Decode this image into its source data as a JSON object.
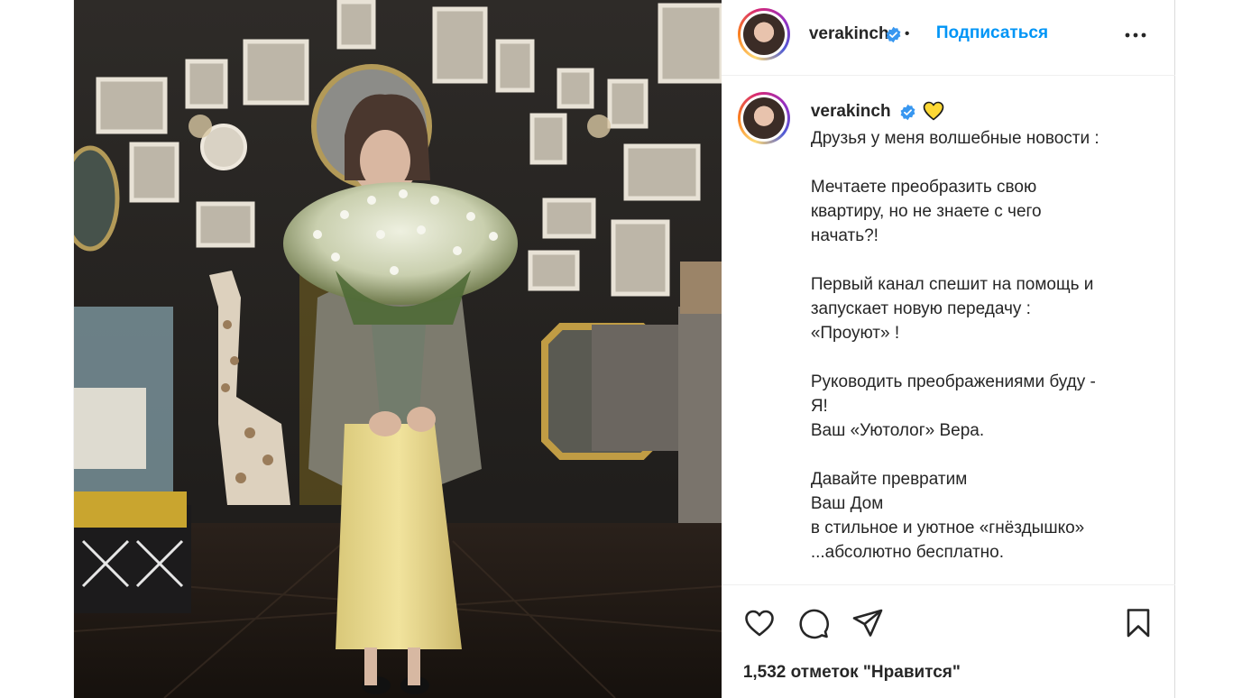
{
  "header": {
    "username": "verakinch",
    "separator": "•",
    "follow_label": "Подписаться",
    "more_icon": "more-horizontal-icon"
  },
  "caption": {
    "username": "verakinch",
    "emoji": "yellow-heart-icon",
    "lines": [
      "Друзья у меня волшебные новости :",
      "",
      "Мечтаете преобразить свою",
      "квартиру, но не знаете с чего",
      "начать?!",
      "",
      "Первый канал спешит на помощь и",
      "запускает новую передачу :",
      "«Проуют» !",
      "",
      "Руководить преображениями буду -",
      "Я!",
      "Ваш «Уютолог» Вера.",
      "",
      "Давайте превратим",
      "Ваш Дом",
      "в стильное и уютное «гнёздышко»",
      "...абсолютно бесплатно."
    ]
  },
  "actions": {
    "like_icon": "heart-icon",
    "comment_icon": "comment-icon",
    "share_icon": "send-icon",
    "save_icon": "bookmark-icon"
  },
  "likes_text": "1,532 отметок \"Нравится\"",
  "colors": {
    "link_blue": "#0095f6",
    "verified_blue": "#3897f0",
    "text": "#262626",
    "heart_yellow": "#fdd835"
  }
}
